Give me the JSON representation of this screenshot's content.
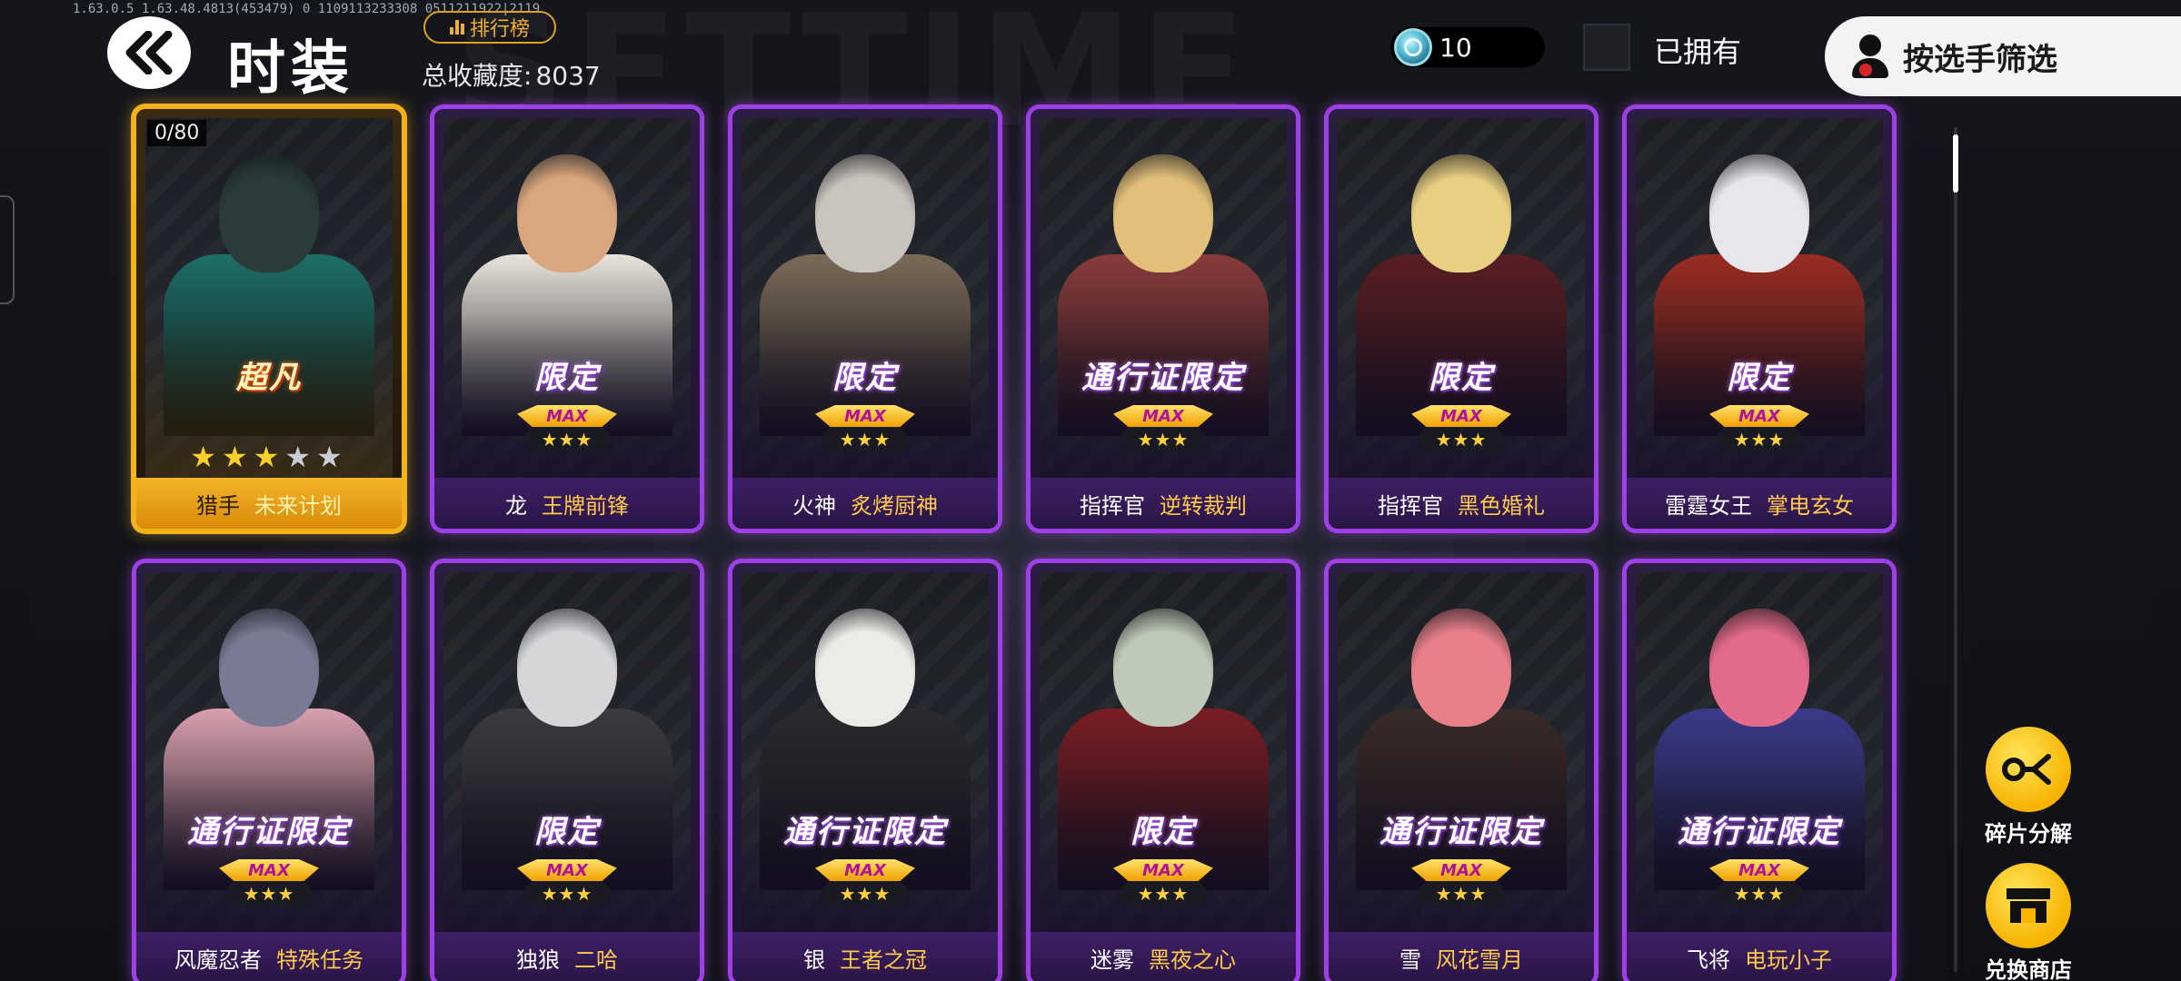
{
  "debug_text": "1.63.0.5  1.63.48.4813(453479)  0  1109113233308   0511211922|2119",
  "background_word": "SETTIME",
  "header": {
    "title": "时装",
    "ranking_label": "排行榜",
    "collection_label": "总收藏度:",
    "collection_value": "8037",
    "currency_amount": "10",
    "owned_label": "已拥有",
    "filter_label": "按选手筛选"
  },
  "colors": {
    "gold": "#f3b21b",
    "purple": "#9f3fe8",
    "yellow_button": "#f7b300"
  },
  "cards": [
    {
      "character": "猎手",
      "skin": "未来计划",
      "tag": "超凡",
      "rarity": "gold",
      "count": "0/80",
      "stars_on": 3,
      "stars_total": 5,
      "palette": [
        "#2a3b3a",
        "#1d6f66"
      ]
    },
    {
      "character": "龙",
      "skin": "王牌前锋",
      "tag": "限定",
      "rarity": "purple",
      "max_label": "MAX",
      "max_stars": "★★★",
      "palette": [
        "#d9a77f",
        "#e8e4dc"
      ]
    },
    {
      "character": "火神",
      "skin": "炙烤厨神",
      "tag": "限定",
      "rarity": "purple",
      "max_label": "MAX",
      "max_stars": "★★★",
      "palette": [
        "#c9c4bd",
        "#7a6a58"
      ]
    },
    {
      "character": "指挥官",
      "skin": "逆转裁判",
      "tag": "通行证限定",
      "rarity": "purple",
      "max_label": "MAX",
      "max_stars": "★★★",
      "palette": [
        "#e2c07a",
        "#8a3b3b"
      ]
    },
    {
      "character": "指挥官",
      "skin": "黑色婚礼",
      "tag": "限定",
      "rarity": "purple",
      "max_label": "MAX",
      "max_stars": "★★★",
      "palette": [
        "#e9cf82",
        "#5a1d24"
      ]
    },
    {
      "character": "雷霆女王",
      "skin": "掌电玄女",
      "tag": "限定",
      "rarity": "purple",
      "max_label": "MAX",
      "max_stars": "★★★",
      "palette": [
        "#e8e6ea",
        "#9a2c22"
      ]
    },
    {
      "character": "风魔忍者",
      "skin": "特殊任务",
      "tag": "通行证限定",
      "rarity": "purple",
      "max_label": "MAX",
      "max_stars": "★★★",
      "palette": [
        "#7a7a95",
        "#d9a0b0"
      ]
    },
    {
      "character": "独狼",
      "skin": "二哈",
      "tag": "限定",
      "rarity": "purple",
      "max_label": "MAX",
      "max_stars": "★★★",
      "palette": [
        "#d6d6d9",
        "#3b3b40"
      ]
    },
    {
      "character": "银",
      "skin": "王者之冠",
      "tag": "通行证限定",
      "rarity": "purple",
      "max_label": "MAX",
      "max_stars": "★★★",
      "palette": [
        "#ecebe8",
        "#2b2b2e"
      ]
    },
    {
      "character": "迷雾",
      "skin": "黑夜之心",
      "tag": "限定",
      "rarity": "purple",
      "max_label": "MAX",
      "max_stars": "★★★",
      "palette": [
        "#bfc9b8",
        "#7a1d24"
      ]
    },
    {
      "character": "雪",
      "skin": "风花雪月",
      "tag": "通行证限定",
      "rarity": "purple",
      "max_label": "MAX",
      "max_stars": "★★★",
      "palette": [
        "#e8808a",
        "#3a2a2a"
      ]
    },
    {
      "character": "飞将",
      "skin": "电玩小子",
      "tag": "通行证限定",
      "rarity": "purple",
      "max_label": "MAX",
      "max_stars": "★★★",
      "palette": [
        "#e36a8a",
        "#3a3a8a"
      ]
    }
  ],
  "side_buttons": {
    "decompose_label": "碎片分解",
    "shop_label": "兑换商店"
  }
}
